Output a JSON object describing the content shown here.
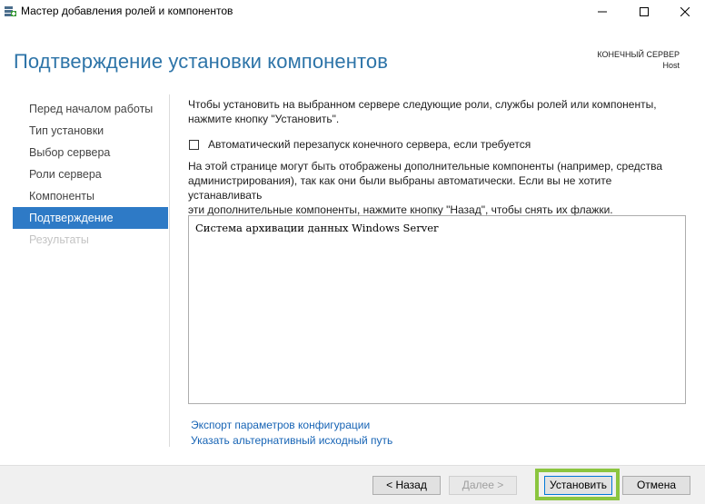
{
  "window": {
    "title": "Мастер добавления ролей и компонентов",
    "icon": "server-manager-icon"
  },
  "header": {
    "page_title": "Подтверждение установки компонентов",
    "destination_label": "КОНЕЧНЫЙ СЕРВЕР",
    "destination_host": "Host"
  },
  "nav": {
    "items": [
      {
        "label": "Перед началом работы",
        "state": "normal"
      },
      {
        "label": "Тип установки",
        "state": "normal"
      },
      {
        "label": "Выбор сервера",
        "state": "normal"
      },
      {
        "label": "Роли сервера",
        "state": "normal"
      },
      {
        "label": "Компоненты",
        "state": "normal"
      },
      {
        "label": "Подтверждение",
        "state": "active"
      },
      {
        "label": "Результаты",
        "state": "disabled"
      }
    ]
  },
  "main": {
    "intro_line1": "Чтобы установить на выбранном сервере следующие роли, службы ролей или компоненты,",
    "intro_line2": "нажмите кнопку \"Установить\".",
    "restart_checkbox_label": "Автоматический перезапуск конечного сервера, если требуется",
    "restart_checked": false,
    "note_line1": "На этой странице могут быть отображены дополнительные компоненты (например, средства",
    "note_line2": "администрирования), так как они были выбраны автоматически. Если вы не хотите устанавливать",
    "note_line3": "эти дополнительные компоненты, нажмите кнопку \"Назад\", чтобы снять их флажки.",
    "features": [
      "Система архивации данных Windows Server"
    ],
    "export_link": "Экспорт параметров конфигурации",
    "alt_source_link": "Указать альтернативный исходный путь"
  },
  "footer": {
    "back_label": "< Назад",
    "next_label": "Далее >",
    "install_label": "Установить",
    "cancel_label": "Отмена",
    "highlight_color": "#8bc53f"
  },
  "colors": {
    "accent": "#2e7ac6",
    "title": "#2d74a8",
    "link": "#1764b5"
  }
}
